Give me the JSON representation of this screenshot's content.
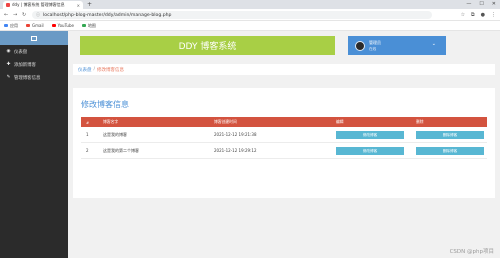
{
  "browser": {
    "tab_title": "ddy | 博客系统 管理博客信息",
    "tab_close": "×",
    "new_tab": "+",
    "win_min": "—",
    "win_max": "☐",
    "win_close": "✕",
    "back": "←",
    "forward": "→",
    "reload": "↻",
    "url_icon": "ⓘ",
    "url": "localhost/php-blog-master/ddy/admin/manage-blog.php",
    "bookmarks": [
      {
        "label": "应用",
        "color": "#4285f4"
      },
      {
        "label": "Gmail",
        "color": "#ea4335"
      },
      {
        "label": "YouTube",
        "color": "#ff0000"
      },
      {
        "label": "地图",
        "color": "#34a853"
      }
    ]
  },
  "sidebar": {
    "items": [
      {
        "label": "仪表盘",
        "icon": "dashboard-icon",
        "glyph": "◉"
      },
      {
        "label": "添加新博客",
        "icon": "add-blog-icon",
        "glyph": "✚"
      },
      {
        "label": "管理博客信息",
        "icon": "edit-icon",
        "glyph": "✎"
      }
    ]
  },
  "header": {
    "title": "DDY 博客系统",
    "user_name": "管理员",
    "user_status": "在线",
    "chevron": "⌄"
  },
  "breadcrumb": {
    "home": "仪表盘",
    "sep": "/",
    "current": "修改博客信息"
  },
  "main": {
    "section_title": "修改博客信息",
    "columns": [
      "#",
      "博客名字",
      "博客创建时间",
      "编辑",
      "删除"
    ],
    "rows": [
      {
        "num": "1",
        "name": "这是我的博客",
        "time": "2021-12-12 19:21:38",
        "edit": "修改博客",
        "delete": "删除博客"
      },
      {
        "num": "2",
        "name": "这是我的第二个博客",
        "time": "2021-12-12 19:29:12",
        "edit": "修改博客",
        "delete": "删除博客"
      }
    ]
  },
  "watermark": "CSDN @php项目",
  "colors": {
    "accent_green": "#a8cf45",
    "accent_blue": "#4a8fd6",
    "table_header": "#d3533f",
    "button": "#58b7d3",
    "sidebar": "#2b2b2b"
  }
}
